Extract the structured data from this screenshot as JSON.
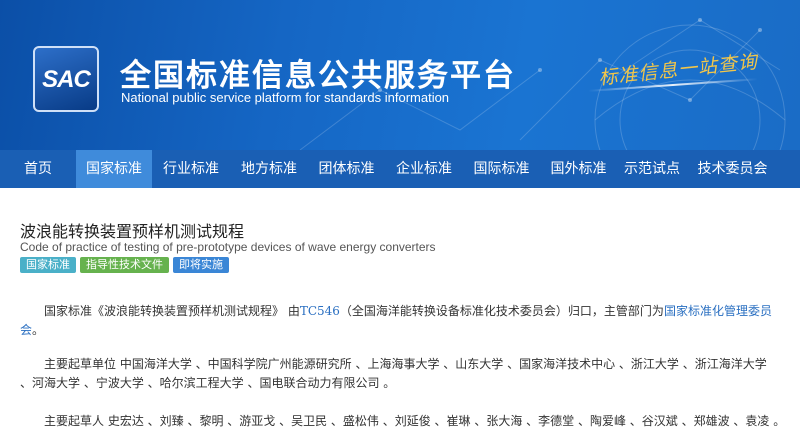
{
  "header": {
    "logo_text": "SAC",
    "title_cn": "全国标准信息公共服务平台",
    "title_en": "National public service platform  for standards information",
    "slogan": "标准信息一站查询"
  },
  "nav": {
    "items": [
      "首页",
      "国家标准",
      "行业标准",
      "地方标准",
      "团体标准",
      "企业标准",
      "国际标准",
      "国外标准",
      "示范试点",
      "技术委员会"
    ],
    "active": "国家标准"
  },
  "standard": {
    "title": "波浪能转换装置预样机测试规程",
    "title_en": "Code of practice of testing of pre-prototype devices of wave energy converters",
    "tags": [
      "国家标准",
      "指导性技术文件",
      "即将实施"
    ]
  },
  "body": {
    "p1_prefix": "国家标准《波浪能转换装置预样机测试规程》 由",
    "p1_tc_code": "TC546",
    "p1_middle": "（全国海洋能转换设备标准化技术委员会）归口，主管部门为",
    "p1_authority": "国家标准化管理委员会",
    "p1_suffix": "。",
    "p2": "主要起草单位 中国海洋大学 、中国科学院广州能源研究所 、上海海事大学 、山东大学 、国家海洋技术中心 、浙江大学 、浙江海洋大学 、河海大学 、宁波大学 、哈尔滨工程大学 、国电联合动力有限公司 。",
    "p3": "主要起草人 史宏达 、刘臻 、黎明 、游亚戈 、吴卫民 、盛松伟 、刘延俊 、崔琳 、张大海 、李德堂 、陶爱峰 、谷汉斌 、郑雄波 、袁凌 。"
  },
  "colors": {
    "banner": "#1566c4",
    "nav_bg": "#1a5fb4",
    "nav_active": "#3f8bdb",
    "link": "#2a6fc1",
    "slogan": "#f2c64a"
  }
}
